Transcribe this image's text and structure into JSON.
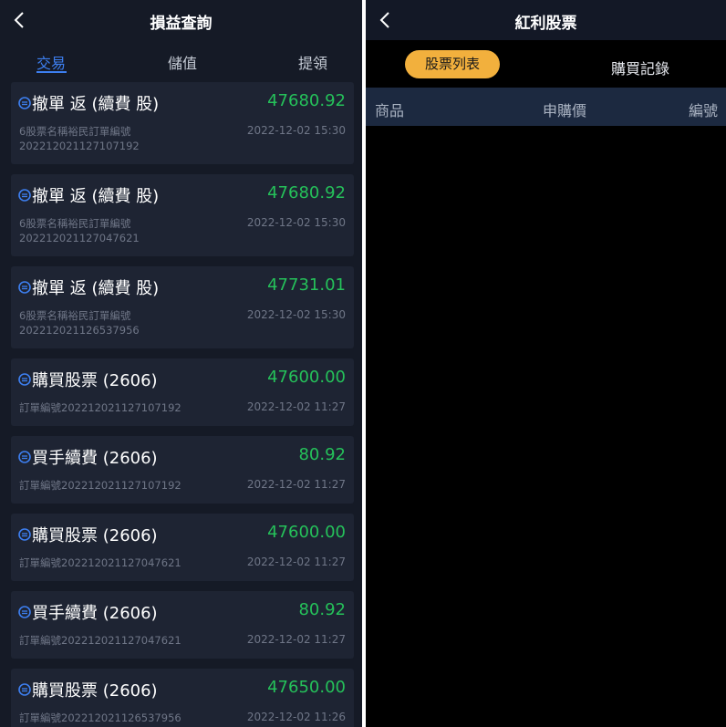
{
  "left": {
    "title": "損益查詢",
    "tabs": [
      {
        "label": "交易",
        "active": true
      },
      {
        "label": "儲值",
        "active": false
      },
      {
        "label": "提領",
        "active": false
      }
    ],
    "records": [
      {
        "name": "撤單 返 (續費 股)",
        "amount": "47680.92",
        "line1": "6股票名稱裕民訂單編號",
        "line2": "202212021127107192",
        "time": "2022-12-02 15:30"
      },
      {
        "name": "撤單 返 (續費 股)",
        "amount": "47680.92",
        "line1": "6股票名稱裕民訂單編號",
        "line2": "202212021127047621",
        "time": "2022-12-02 15:30"
      },
      {
        "name": "撤單 返 (續費 股)",
        "amount": "47731.01",
        "line1": "6股票名稱裕民訂單編號",
        "line2": "202212021126537956",
        "time": "2022-12-02 15:30"
      },
      {
        "name": "購買股票 (2606)",
        "amount": "47600.00",
        "line1": "訂單編號202212021127107192",
        "line2": "",
        "time": "2022-12-02 11:27"
      },
      {
        "name": "買手續費 (2606)",
        "amount": "80.92",
        "line1": "訂單編號202212021127107192",
        "line2": "",
        "time": "2022-12-02 11:27"
      },
      {
        "name": "購買股票 (2606)",
        "amount": "47600.00",
        "line1": "訂單編號202212021127047621",
        "line2": "",
        "time": "2022-12-02 11:27"
      },
      {
        "name": "買手續費 (2606)",
        "amount": "80.92",
        "line1": "訂單編號202212021127047621",
        "line2": "",
        "time": "2022-12-02 11:27"
      },
      {
        "name": "購買股票 (2606)",
        "amount": "47650.00",
        "line1": "訂單編號202212021126537956",
        "line2": "",
        "time": "2022-12-02 11:26"
      }
    ]
  },
  "right": {
    "title": "紅利股票",
    "segments": {
      "active": "股票列表",
      "other": "購買記錄"
    },
    "columns": [
      "商品",
      "申購價",
      "編號"
    ]
  },
  "colors": {
    "accent_blue": "#3d7ff0",
    "amount_green": "#25c15a",
    "segment_orange": "#f2b03d"
  },
  "icons": {
    "back": "chevron-left-icon",
    "record": "circle-minus-icon"
  }
}
